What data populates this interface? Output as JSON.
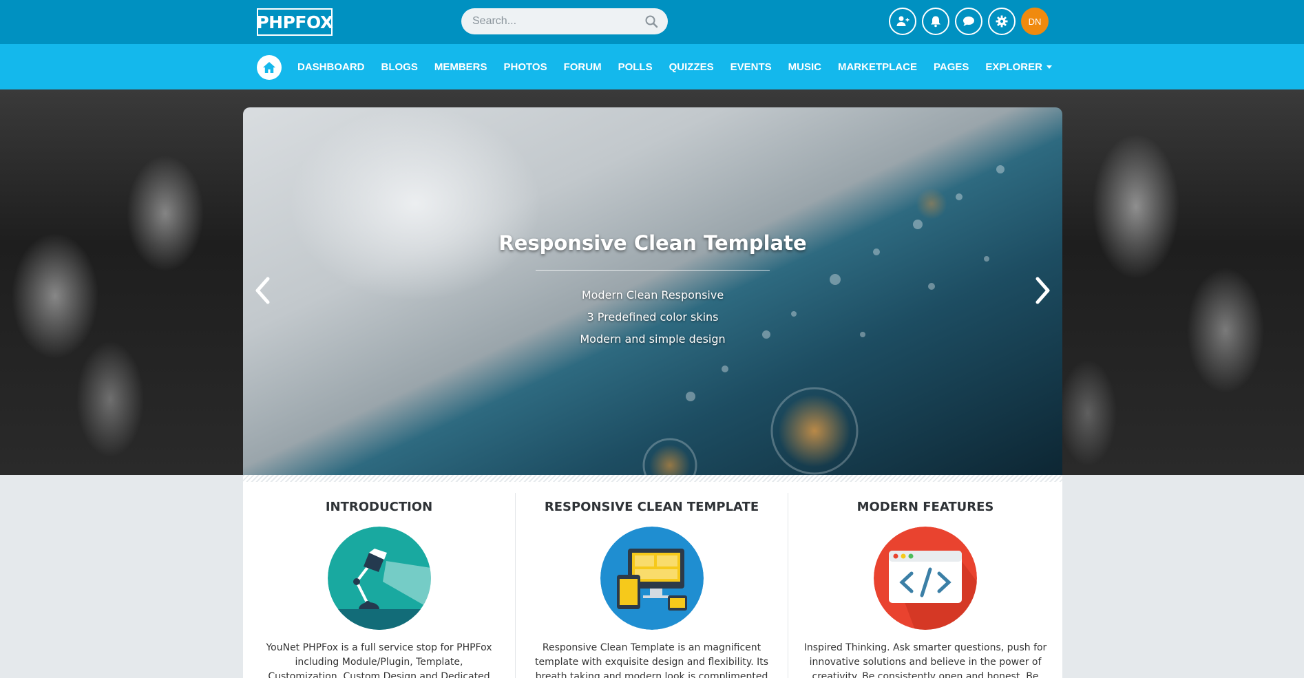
{
  "header": {
    "logo": "PHPFOX",
    "search_placeholder": "Search...",
    "avatar_initials": "DN"
  },
  "nav": {
    "items": [
      "DASHBOARD",
      "BLOGS",
      "MEMBERS",
      "PHOTOS",
      "FORUM",
      "POLLS",
      "QUIZZES",
      "EVENTS",
      "MUSIC",
      "MARKETPLACE",
      "PAGES",
      "EXPLORER"
    ]
  },
  "slider": {
    "title": "Responsive Clean Template",
    "lines": [
      "Modern Clean Responsive",
      "3 Predefined color skins",
      "Modern and simple design"
    ]
  },
  "features": [
    {
      "title": "INTRODUCTION",
      "icon": "desk-lamp-icon",
      "text": "YouNet PHPFox is a full service stop for PHPFox including Module/Plugin, Template, Customization, Custom Design and Dedicated Developer. With more"
    },
    {
      "title": "RESPONSIVE CLEAN TEMPLATE",
      "icon": "devices-icon",
      "text": "Responsive Clean Template is an magnificent template with exquisite design and flexibility. Its breath taking and modern look is complimented with"
    },
    {
      "title": "MODERN FEATURES",
      "icon": "code-window-icon",
      "text": "Inspired Thinking. Ask smarter questions, push for innovative solutions and believe in the power of creativity. Be consistently open and honest. Be true to"
    }
  ],
  "colors": {
    "topbar": "#0091c1",
    "navbar": "#14b8ec",
    "avatar": "#f08a0e"
  }
}
